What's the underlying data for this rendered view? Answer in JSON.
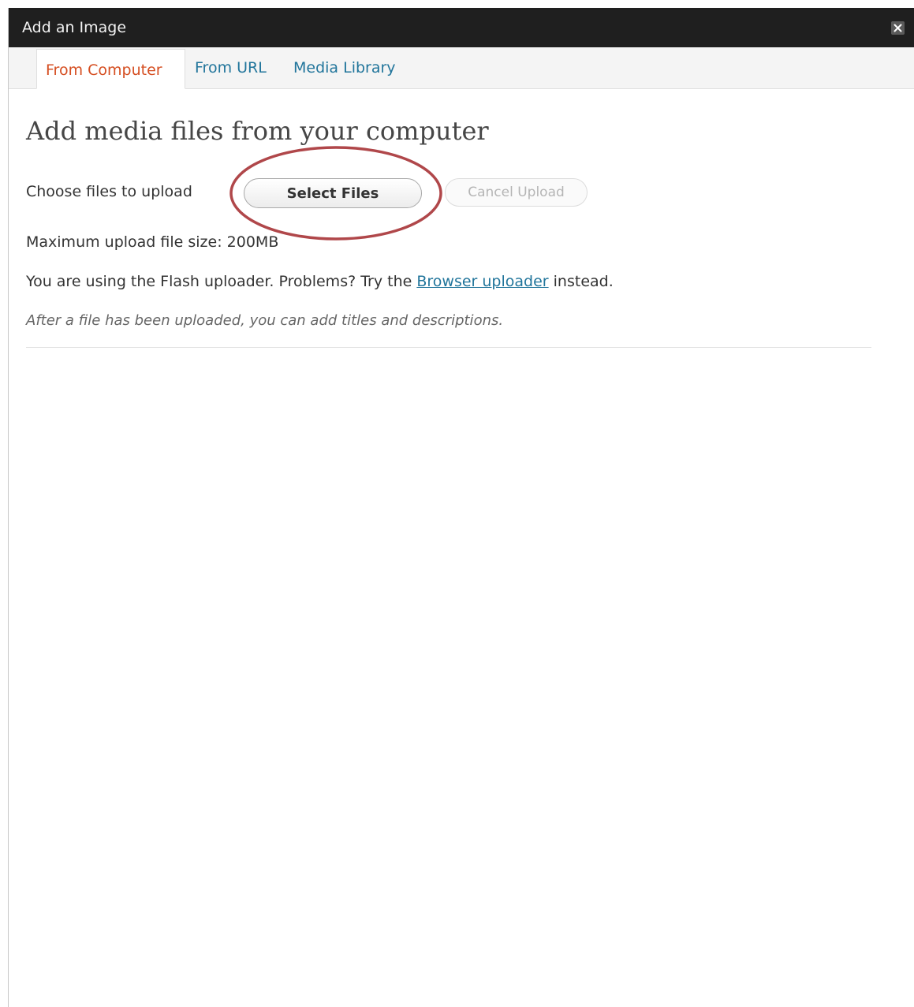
{
  "window": {
    "title": "Add an Image"
  },
  "tabs": [
    {
      "label": "From Computer",
      "active": true
    },
    {
      "label": "From URL",
      "active": false
    },
    {
      "label": "Media Library",
      "active": false
    }
  ],
  "upload": {
    "heading": "Add media files from your computer",
    "choose_label": "Choose files to upload",
    "select_button": "Select Files",
    "cancel_button": "Cancel Upload",
    "max_size": "Maximum upload file size: 200MB",
    "flash_prefix": "You are using the Flash uploader. Problems? Try the",
    "flash_link": "Browser uploader",
    "flash_suffix": "instead.",
    "after_note": "After a file has been uploaded, you can add titles and descriptions."
  },
  "colors": {
    "titlebar": "#1f1f1f",
    "active_tab": "#d54e21",
    "link": "#21759b",
    "highlight_ring": "#b0474a"
  },
  "icons": {
    "close": "close-icon"
  }
}
